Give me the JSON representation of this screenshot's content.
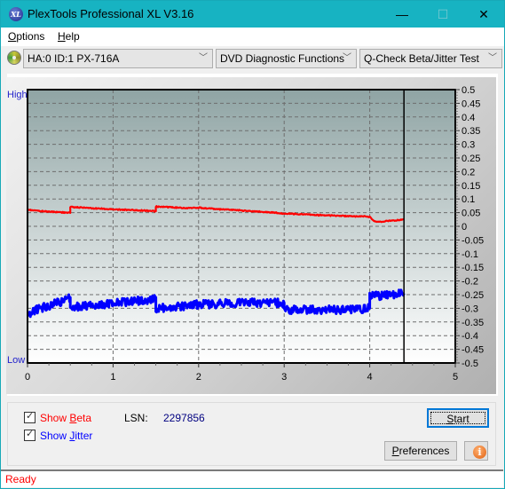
{
  "window": {
    "title": "PlexTools Professional XL V3.16",
    "app_icon": "xl-logo-icon",
    "controls": [
      "minimize",
      "maximize",
      "close"
    ]
  },
  "menu": [
    {
      "label": "Options",
      "accel": "O",
      "rest": "ptions"
    },
    {
      "label": "Help",
      "accel": "H",
      "rest": "elp"
    }
  ],
  "toolbar": {
    "drive": "HA:0 ID:1  PX-716A",
    "function": "DVD Diagnostic Functions",
    "test": "Q-Check Beta/Jitter Test"
  },
  "chart_labels": {
    "high": "High",
    "low": "Low"
  },
  "chart_data": {
    "type": "line",
    "title": "",
    "xlabel": "",
    "ylabel": "",
    "xlim": [
      0,
      5
    ],
    "ylim": [
      -0.5,
      0.5
    ],
    "x_ticks": [
      "0",
      "1",
      "2",
      "3",
      "4",
      "5"
    ],
    "y_ticks": [
      "0.5",
      "0.45",
      "0.4",
      "0.35",
      "0.3",
      "0.25",
      "0.2",
      "0.15",
      "0.1",
      "0.05",
      "0",
      "-0.05",
      "-0.1",
      "-0.15",
      "-0.2",
      "-0.25",
      "-0.3",
      "-0.35",
      "-0.4",
      "-0.45",
      "-0.5"
    ],
    "grid": true,
    "progress_marker_x": 4.4,
    "series": [
      {
        "name": "Beta",
        "color": "#ff0000",
        "x": [
          0,
          0.1,
          0.2,
          0.3,
          0.4,
          0.5,
          0.5,
          0.7,
          0.9,
          1.0,
          1.2,
          1.4,
          1.5,
          1.5,
          1.7,
          1.9,
          2.0,
          2.2,
          2.4,
          2.6,
          2.8,
          3.0,
          3.2,
          3.4,
          3.6,
          3.8,
          4.0,
          4.05,
          4.1,
          4.2,
          4.3,
          4.4
        ],
        "values": [
          0.06,
          0.057,
          0.055,
          0.053,
          0.051,
          0.049,
          0.071,
          0.067,
          0.064,
          0.062,
          0.06,
          0.057,
          0.055,
          0.072,
          0.069,
          0.066,
          0.068,
          0.063,
          0.06,
          0.056,
          0.052,
          0.047,
          0.044,
          0.041,
          0.039,
          0.037,
          0.035,
          0.02,
          0.016,
          0.019,
          0.022,
          0.025
        ]
      },
      {
        "name": "Jitter",
        "color": "#0000ff",
        "x": [
          0,
          0.05,
          0.1,
          0.2,
          0.3,
          0.4,
          0.5,
          0.5,
          0.7,
          0.9,
          1.0,
          1.2,
          1.4,
          1.5,
          1.5,
          1.7,
          1.9,
          2.0,
          2.2,
          2.4,
          2.6,
          2.8,
          3.0,
          3.0,
          3.2,
          3.4,
          3.6,
          3.8,
          4.0,
          4.0,
          4.1,
          4.2,
          4.3,
          4.4
        ],
        "values": [
          -0.32,
          -0.315,
          -0.305,
          -0.295,
          -0.285,
          -0.275,
          -0.26,
          -0.295,
          -0.29,
          -0.285,
          -0.28,
          -0.275,
          -0.27,
          -0.26,
          -0.3,
          -0.295,
          -0.29,
          -0.285,
          -0.285,
          -0.28,
          -0.28,
          -0.28,
          -0.28,
          -0.305,
          -0.305,
          -0.305,
          -0.305,
          -0.305,
          -0.3,
          -0.255,
          -0.255,
          -0.252,
          -0.25,
          -0.245
        ]
      }
    ]
  },
  "controls": {
    "show_beta": {
      "label_pre": "Show ",
      "accel": "B",
      "label_post": "eta",
      "checked": true,
      "color": "#ff0000"
    },
    "show_jitter": {
      "label_pre": "Show ",
      "accel": "J",
      "label_post": "itter",
      "checked": true,
      "color": "#0000ff"
    },
    "lsn_label": "LSN:",
    "lsn_value": "2297856",
    "start": {
      "accel": "S",
      "rest": "tart"
    },
    "preferences": {
      "accel": "P",
      "rest": "references"
    },
    "info_icon": "info-icon"
  },
  "status": {
    "text": "Ready"
  }
}
